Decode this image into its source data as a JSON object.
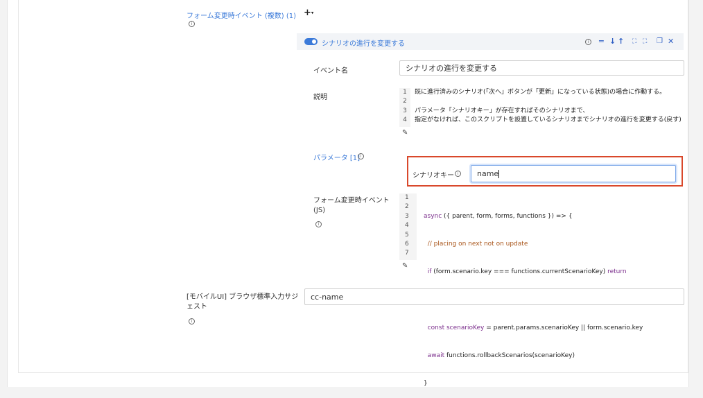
{
  "form_change_events": {
    "label": "フォーム変更時イベント (複数) (1)",
    "add_label": "+",
    "add_caret": "▾"
  },
  "event": {
    "header_title": "シナリオの進行を変更する",
    "header_icons": [
      "info-icon",
      "move-bottom-icon",
      "move-down-icon",
      "move-up-icon",
      "collapse-icon",
      "expand-icon",
      "copy-icon",
      "close-icon"
    ],
    "name_label": "イベント名",
    "name_value": "シナリオの進行を変更する",
    "description_label": "説明",
    "description_lines": [
      {
        "num": "1",
        "text": "既に進行済みのシナリオ(「次へ」ボタンが「更新」になっている状態)の場合に作動する。"
      },
      {
        "num": "2",
        "text": ""
      },
      {
        "num": "3",
        "text": "パラメータ「シナリオキー」が存在すればそのシナリオまで、"
      },
      {
        "num": "4",
        "text": "指定がなければ、このスクリプトを設置しているシナリオまでシナリオの進行を変更する(戻す)"
      }
    ],
    "params_label": "パラメータ [1]",
    "scenario_key_label": "シナリオキー",
    "scenario_key_value": "name",
    "js_label_line1": "フォーム変更時イベント",
    "js_label_line2": "(JS)",
    "code_lines": [
      {
        "num": "1",
        "kw": "async",
        "text": " ({ parent, form, forms, functions }) => {"
      },
      {
        "num": "2",
        "comment": "  // placing on next not on update"
      },
      {
        "num": "3",
        "kw": "  if",
        "text": " (form.scenario.key === functions.currentScenarioKey) ",
        "kw2": "return"
      },
      {
        "num": "4",
        "text": ""
      },
      {
        "num": "5",
        "kw": "  const scenarioKey",
        "text": " = parent.params.scenarioKey || form.scenario.key"
      },
      {
        "num": "6",
        "kw": "  await",
        "text": " functions.rollbackScenarios(scenarioKey)"
      },
      {
        "num": "7",
        "text": "}"
      }
    ]
  },
  "mobile_ui": {
    "label_line1": "[モバイルUI] ブラウザ標準入力サジ",
    "label_line2": "ェスト",
    "value": "cc-name"
  }
}
